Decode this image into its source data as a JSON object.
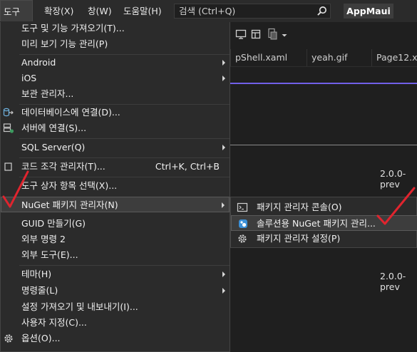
{
  "menubar": {
    "tools": "도구(T)",
    "extensions": "확장(X)",
    "window": "창(W)",
    "help": "도움말(H)"
  },
  "search": {
    "label": "검색 (Ctrl+Q)"
  },
  "app": {
    "title": "AppMaui"
  },
  "tabs": [
    "pShell.xaml",
    "yeah.gif",
    "Page12.xa"
  ],
  "editor": {
    "version1": "2.0.0-prev",
    "version2": "2.0.0-prev"
  },
  "tools_menu": {
    "get_tools": "도구 및 기능 가져오기(T)...",
    "preview_features": "미리 보기 기능 관리(P)",
    "android": "Android",
    "ios": "iOS",
    "security_manager": "보관 관리자...",
    "connect_db": "데이터베이스에 연결(D)...",
    "connect_server": "서버에 연결(S)...",
    "sql_server": "SQL Server(Q)",
    "snippet_manager": "코드 조각 관리자(T)...",
    "snippet_shortcut": "Ctrl+K, Ctrl+B",
    "toolbox_items": "도구 상자 항목 선택(X)...",
    "nuget_manager": "NuGet 패키지 관리자(N)",
    "create_guid": "GUID 만들기(G)",
    "external_cmd2": "외부 명령 2",
    "external_tools": "외부 도구(E)...",
    "theme": "테마(H)",
    "command_line": "명령줄(L)",
    "import_export": "설정 가져오기 및 내보내기(I)...",
    "customize": "사용자 지정(C)...",
    "options": "옵션(O)..."
  },
  "nuget_submenu": {
    "console": "패키지 관리자 콘솔(O)",
    "manage_solution": "솔루션용 NuGet 패키지 관리...",
    "settings": "패키지 관리자 설정(P)"
  },
  "colors": {
    "accent": "#7160e8",
    "annotation": "#e0242e",
    "menu_bg": "#2b2b2b"
  }
}
